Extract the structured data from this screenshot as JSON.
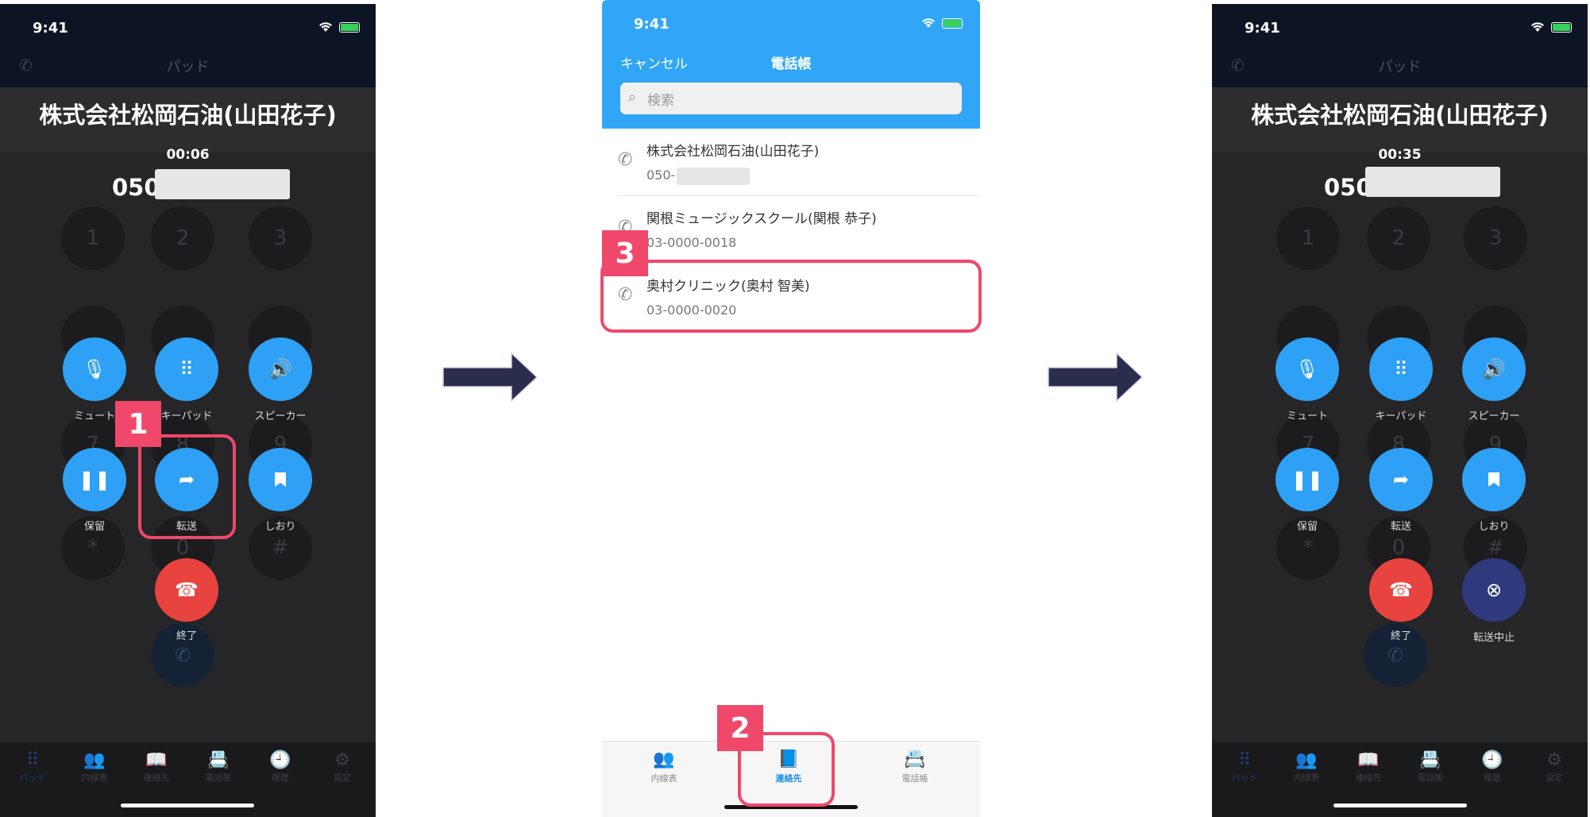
{
  "left_phone": {
    "status": {
      "time": "9:41"
    },
    "nav": {
      "title": "パッド"
    },
    "call": {
      "title": "株式会社松岡石油(山田花子)",
      "duration": "00:06",
      "number_prefix": "050"
    },
    "keypad": [
      "1",
      "2",
      "3",
      "7",
      "8",
      "9",
      "*",
      "0",
      "#"
    ],
    "actions": {
      "mute": "ミュート",
      "keypad": "キーパッド",
      "speaker": "スピーカー",
      "hold": "保留",
      "transfer": "転送",
      "bookmark": "しおり",
      "end": "終了"
    },
    "tabs": [
      "パッド",
      "内線表",
      "連絡先",
      "電話帳",
      "履歴",
      "設定"
    ]
  },
  "contacts_phone": {
    "status": {
      "time": "9:41"
    },
    "nav": {
      "cancel": "キャンセル",
      "title": "電話帳"
    },
    "search": {
      "placeholder": "検索"
    },
    "contacts": [
      {
        "name": "株式会社松岡石油(山田花子)",
        "phone": "050-"
      },
      {
        "name": "関根ミュージックスクール(関根 恭子)",
        "phone": "03-0000-0018"
      },
      {
        "name": "奥村クリニック(奥村 智美)",
        "phone": "03-0000-0020"
      }
    ],
    "tabs": [
      "内線表",
      "連絡先",
      "電話帳"
    ]
  },
  "right_phone": {
    "status": {
      "time": "9:41"
    },
    "nav": {
      "title": "パッド"
    },
    "call": {
      "title": "株式会社松岡石油(山田花子)",
      "duration": "00:35",
      "number_prefix": "050"
    },
    "keypad": [
      "1",
      "2",
      "3",
      "7",
      "8",
      "9",
      "*",
      "0",
      "#"
    ],
    "actions": {
      "mute": "ミュート",
      "keypad": "キーパッド",
      "speaker": "スピーカー",
      "hold": "保留",
      "transfer": "転送",
      "bookmark": "しおり",
      "end": "終了",
      "cancel_transfer": "転送中止"
    },
    "tabs": [
      "パッド",
      "内線表",
      "連絡先",
      "電話帳",
      "履歴",
      "設定"
    ]
  },
  "annotations": {
    "step1": "1",
    "step2": "2",
    "step3": "3"
  },
  "colors": {
    "accent_blue": "#2ea0f5",
    "end_red": "#e8433f",
    "highlight_pink": "#f0486a",
    "arrow_navy": "#2b2d4d"
  }
}
